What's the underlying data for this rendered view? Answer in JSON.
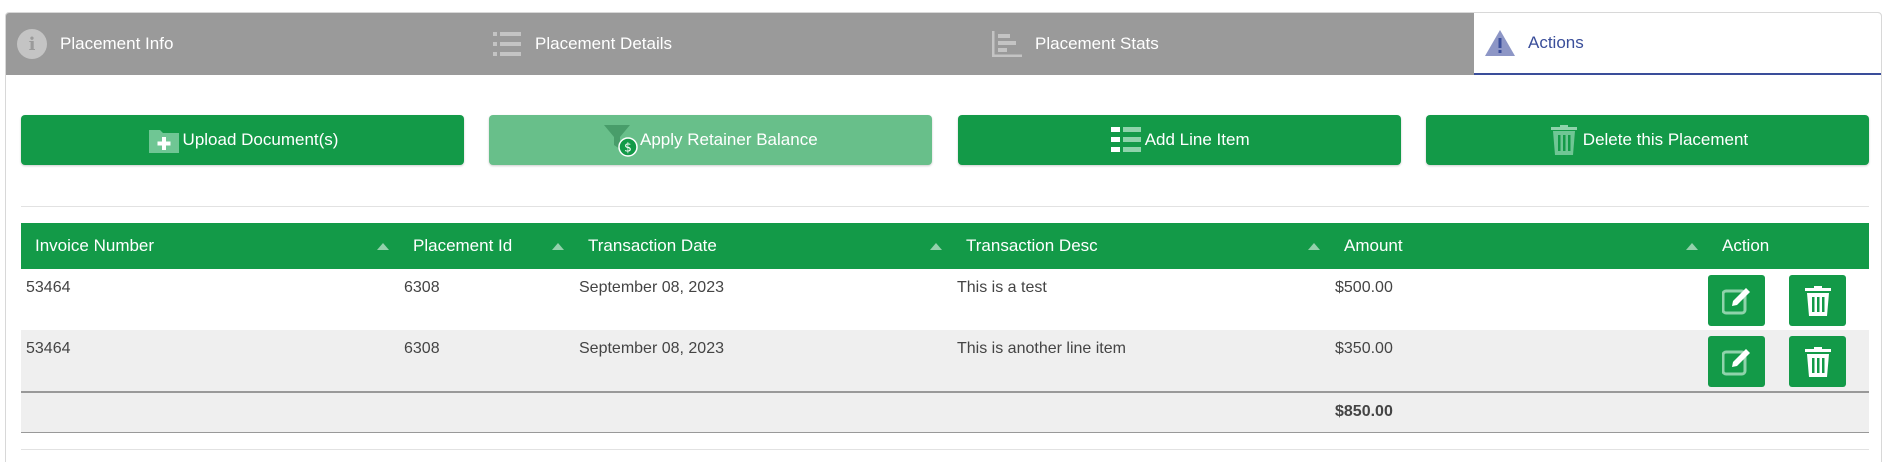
{
  "tabs": [
    {
      "label": "Placement Info",
      "icon": "info-icon",
      "active": false
    },
    {
      "label": "Placement Details",
      "icon": "list-icon",
      "active": false
    },
    {
      "label": "Placement Stats",
      "icon": "bar-chart-icon",
      "active": false
    },
    {
      "label": "Actions",
      "icon": "warning-icon",
      "active": true
    }
  ],
  "buttons": {
    "upload": "Upload Document(s)",
    "apply_retainer": "Apply Retainer Balance",
    "add_line": "Add Line Item",
    "delete_placement": "Delete this Placement"
  },
  "table": {
    "headers": [
      "Invoice Number",
      "Placement Id",
      "Transaction Date",
      "Transaction Desc",
      "Amount",
      "Action"
    ],
    "rows": [
      {
        "invoice": "53464",
        "placement_id": "6308",
        "date": "September 08, 2023",
        "desc": "This is a test",
        "amount": "$500.00"
      },
      {
        "invoice": "53464",
        "placement_id": "6308",
        "date": "September 08, 2023",
        "desc": "This is another line item",
        "amount": "$350.00"
      }
    ],
    "total": "$850.00"
  },
  "colors": {
    "accent_green": "#139a48",
    "disabled_green": "#68bf8a",
    "tab_gray": "#9a9a9a",
    "active_tab_blue": "#3a4e9a"
  }
}
